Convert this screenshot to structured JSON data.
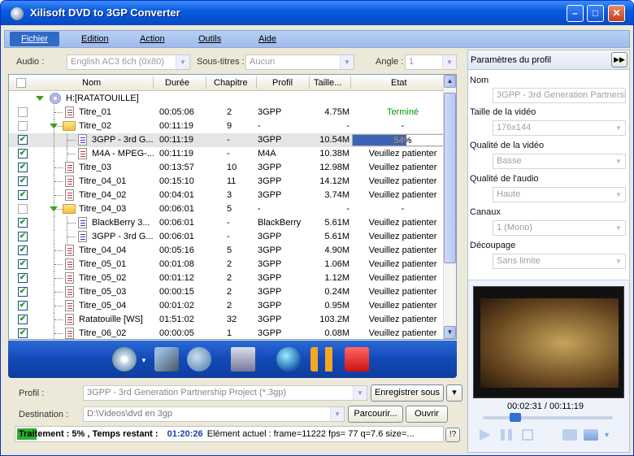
{
  "window": {
    "title": "Xilisoft DVD to 3GP Converter"
  },
  "menu": [
    "Fichier",
    "Edition",
    "Action",
    "Outils",
    "Aide"
  ],
  "filters": {
    "audio_label": "Audio :",
    "audio_value": "English AC3 6ch (0x80)",
    "subs_label": "Sous-titres :",
    "subs_value": "Aucun",
    "angle_label": "Angle :",
    "angle_value": "1"
  },
  "columns": [
    "Nom",
    "Durée",
    "Chapitre",
    "Profil",
    "Taille...",
    "Etat"
  ],
  "root": "H:[RATATOUILLE]",
  "rows": [
    {
      "name": "Titre_01",
      "dur": "00:05:06",
      "chap": "2",
      "prof": "3GPP",
      "size": "4.75M",
      "state": "Terminé",
      "checked": false,
      "indent": 0,
      "kind": "doc"
    },
    {
      "name": "Titre_02",
      "dur": "00:11:19",
      "chap": "9",
      "prof": "-",
      "size": "-",
      "state": "-",
      "checked": false,
      "indent": 0,
      "kind": "folder"
    },
    {
      "name": "3GPP - 3rd G...",
      "dur": "00:11:19",
      "chap": "-",
      "prof": "3GPP",
      "size": "10.54M",
      "state": "54%",
      "checked": true,
      "indent": 1,
      "kind": "doc-blue",
      "progress": 0.54
    },
    {
      "name": "M4A - MPEG-...",
      "dur": "00:11:19",
      "chap": "-",
      "prof": "M4A",
      "size": "10.38M",
      "state": "Veuillez patienter",
      "checked": true,
      "indent": 1,
      "kind": "doc"
    },
    {
      "name": "Titre_03",
      "dur": "00:13:57",
      "chap": "10",
      "prof": "3GPP",
      "size": "12.98M",
      "state": "Veuillez patienter",
      "checked": true,
      "indent": 0,
      "kind": "doc"
    },
    {
      "name": "Titre_04_01",
      "dur": "00:15:10",
      "chap": "11",
      "prof": "3GPP",
      "size": "14.12M",
      "state": "Veuillez patienter",
      "checked": true,
      "indent": 0,
      "kind": "doc"
    },
    {
      "name": "Titre_04_02",
      "dur": "00:04:01",
      "chap": "3",
      "prof": "3GPP",
      "size": "3.74M",
      "state": "Veuillez patienter",
      "checked": true,
      "indent": 0,
      "kind": "doc"
    },
    {
      "name": "Titre_04_03",
      "dur": "00:06:01",
      "chap": "5",
      "prof": "-",
      "size": "-",
      "state": "-",
      "checked": false,
      "indent": 0,
      "kind": "folder"
    },
    {
      "name": "BlackBerry 3...",
      "dur": "00:06:01",
      "chap": "-",
      "prof": "BlackBerry",
      "size": "5.61M",
      "state": "Veuillez patienter",
      "checked": true,
      "indent": 1,
      "kind": "doc-blue"
    },
    {
      "name": "3GPP - 3rd G...",
      "dur": "00:06:01",
      "chap": "-",
      "prof": "3GPP",
      "size": "5.61M",
      "state": "Veuillez patienter",
      "checked": true,
      "indent": 1,
      "kind": "doc-blue"
    },
    {
      "name": "Titre_04_04",
      "dur": "00:05:16",
      "chap": "5",
      "prof": "3GPP",
      "size": "4.90M",
      "state": "Veuillez patienter",
      "checked": true,
      "indent": 0,
      "kind": "doc"
    },
    {
      "name": "Titre_05_01",
      "dur": "00:01:08",
      "chap": "2",
      "prof": "3GPP",
      "size": "1.06M",
      "state": "Veuillez patienter",
      "checked": true,
      "indent": 0,
      "kind": "doc"
    },
    {
      "name": "Titre_05_02",
      "dur": "00:01:12",
      "chap": "2",
      "prof": "3GPP",
      "size": "1.12M",
      "state": "Veuillez patienter",
      "checked": true,
      "indent": 0,
      "kind": "doc"
    },
    {
      "name": "Titre_05_03",
      "dur": "00:00:15",
      "chap": "2",
      "prof": "3GPP",
      "size": "0.24M",
      "state": "Veuillez patienter",
      "checked": true,
      "indent": 0,
      "kind": "doc"
    },
    {
      "name": "Titre_05_04",
      "dur": "00:01:02",
      "chap": "2",
      "prof": "3GPP",
      "size": "0.95M",
      "state": "Veuillez patienter",
      "checked": true,
      "indent": 0,
      "kind": "doc"
    },
    {
      "name": "Ratatouille [WS]",
      "dur": "01:51:02",
      "chap": "32",
      "prof": "3GPP",
      "size": "103.2M",
      "state": "Veuillez patienter",
      "checked": true,
      "indent": 0,
      "kind": "doc"
    },
    {
      "name": "Titre_06_02",
      "dur": "00:00:05",
      "chap": "1",
      "prof": "3GPP",
      "size": "0.08M",
      "state": "Veuillez patienter",
      "checked": true,
      "indent": 0,
      "kind": "doc"
    }
  ],
  "bottom": {
    "profil_label": "Profil :",
    "profil_value": "3GPP - 3rd Generation Partnership Project  (*.3gp)",
    "save_as": "Enregistrer sous",
    "dest_label": "Destination :",
    "dest_value": "D:\\Videos\\dvd en 3gp",
    "browse": "Parcourir...",
    "open": "Ouvrir",
    "status_main": "Traitement : 5% , Temps restant :",
    "status_time": "01:20:26",
    "status_detail": "Elément actuel : frame=11222 fps= 77 q=7.6 size=...",
    "help": "!?"
  },
  "right": {
    "header": "Paramètres du profil",
    "nom_label": "Nom",
    "nom_value": "3GPP - 3rd Generation Partnersh",
    "taille_label": "Taille de la vidéo",
    "taille_value": "176x144",
    "qv_label": "Qualité de la vidéo",
    "qv_value": "Basse",
    "qa_label": "Qualité de l'audio",
    "qa_value": "Haute",
    "canaux_label": "Canaux",
    "canaux_value": "1 (Mono)",
    "decoup_label": "Découpage",
    "decoup_value": "Sans limite",
    "time": "00:02:31 / 00:11:19"
  },
  "colors": {
    "accent": "#316AC5",
    "done": "#009900",
    "progress": "#3d63b4"
  }
}
